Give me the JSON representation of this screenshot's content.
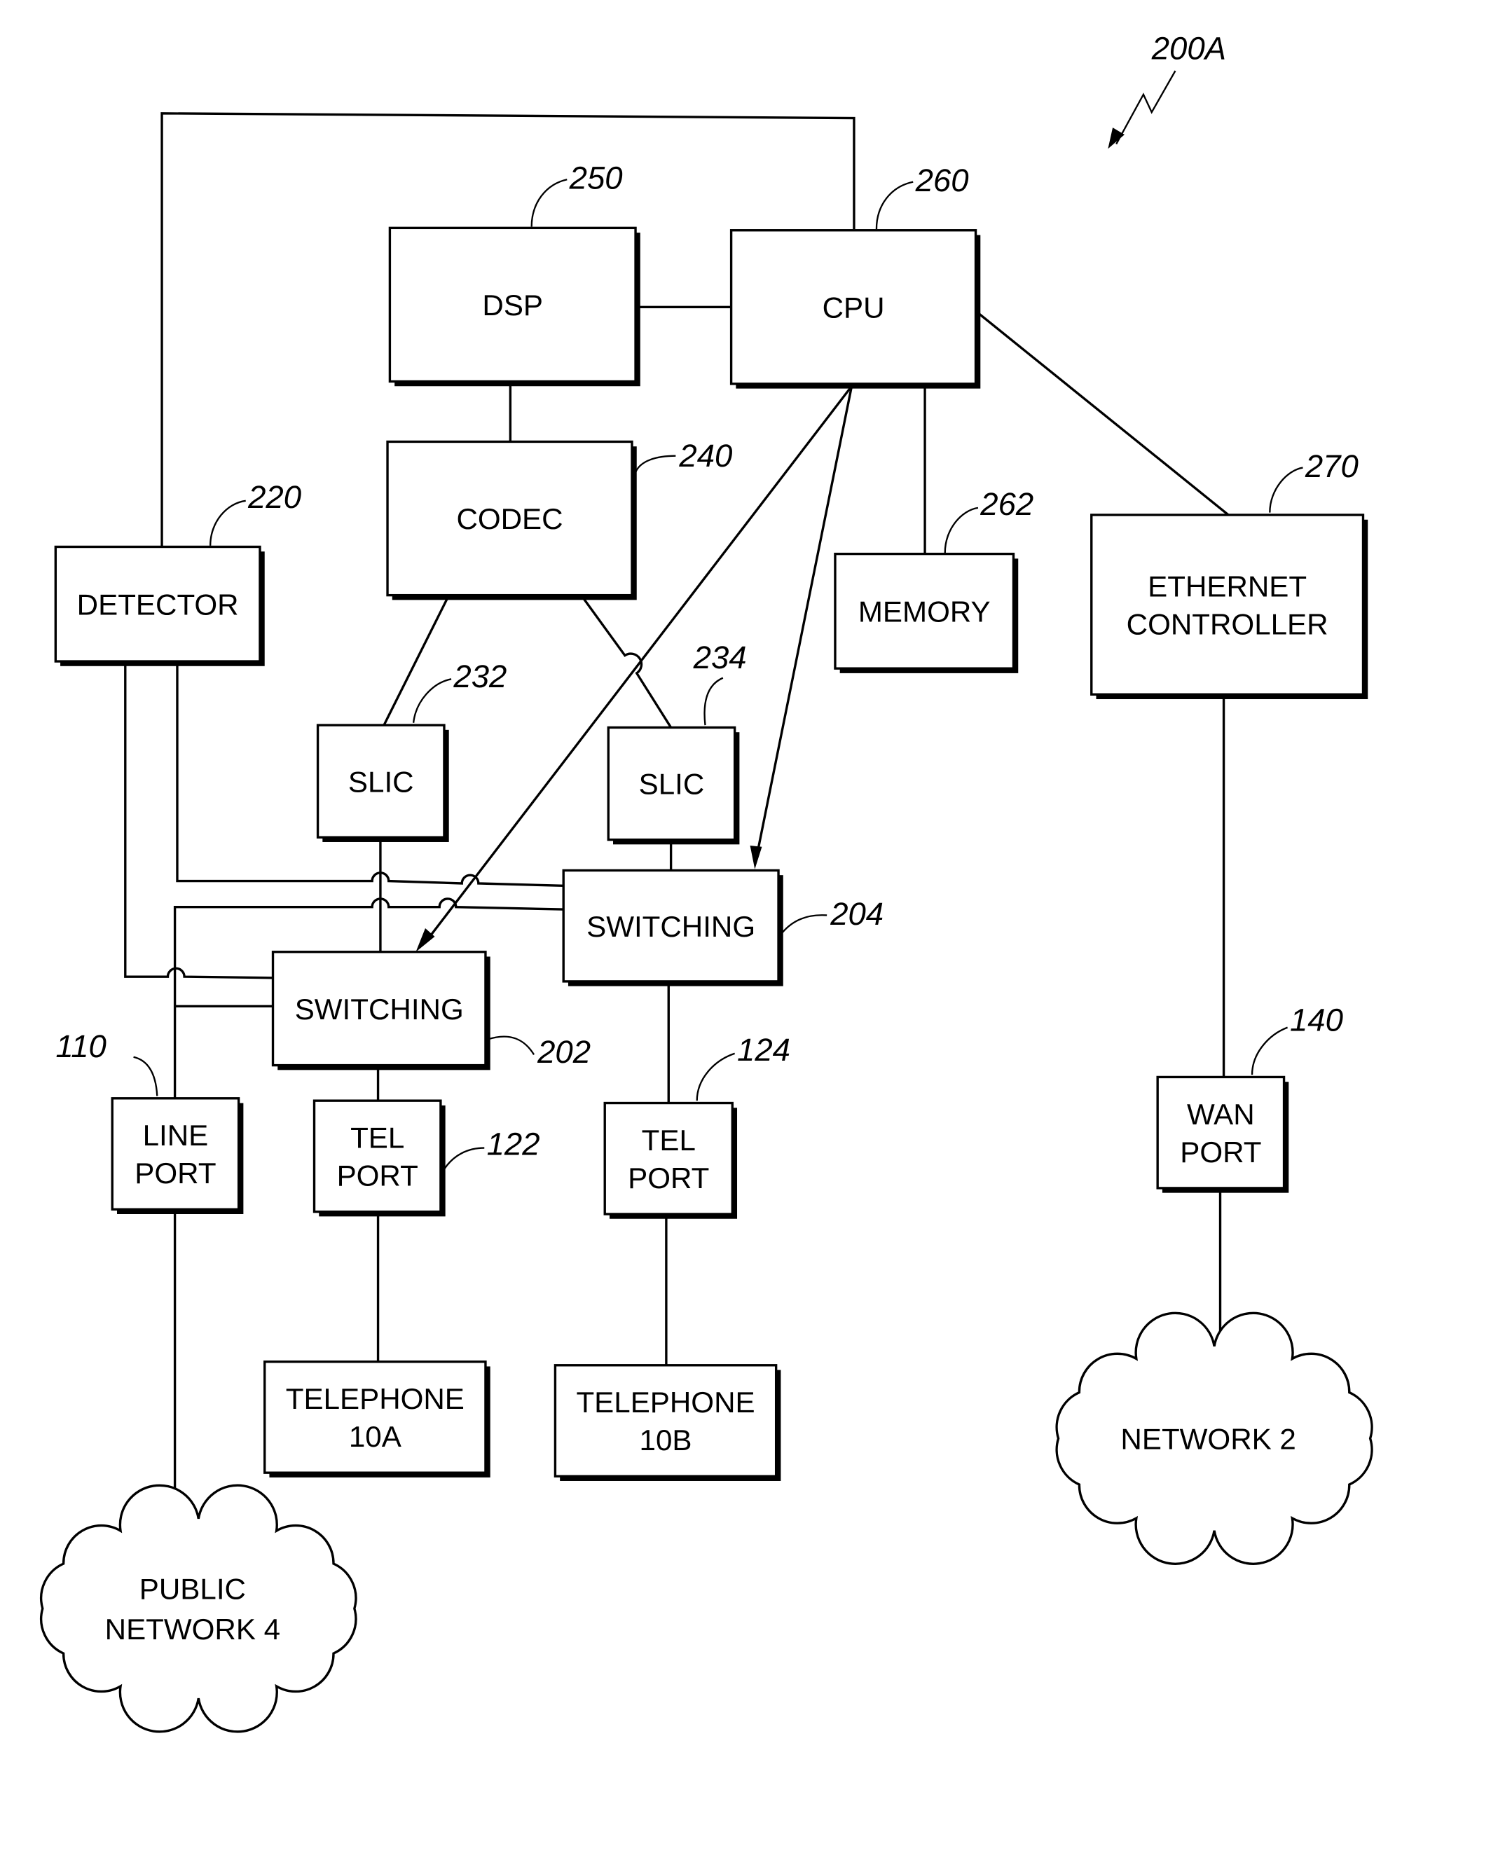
{
  "figure": {
    "reference": "200A",
    "blocks": [
      {
        "id": "dsp",
        "lines": [
          "DSP"
        ],
        "ref": "250"
      },
      {
        "id": "cpu",
        "lines": [
          "CPU"
        ],
        "ref": "260"
      },
      {
        "id": "codec",
        "lines": [
          "CODEC"
        ],
        "ref": "240"
      },
      {
        "id": "detector",
        "lines": [
          "DETECTOR"
        ],
        "ref": "220"
      },
      {
        "id": "memory",
        "lines": [
          "MEMORY"
        ],
        "ref": "262"
      },
      {
        "id": "ethernet",
        "lines": [
          "ETHERNET",
          "CONTROLLER"
        ],
        "ref": "270"
      },
      {
        "id": "slic1",
        "lines": [
          "SLIC"
        ],
        "ref": "232"
      },
      {
        "id": "slic2",
        "lines": [
          "SLIC"
        ],
        "ref": "234"
      },
      {
        "id": "switch204",
        "lines": [
          "SWITCHING"
        ],
        "ref": "204"
      },
      {
        "id": "switch202",
        "lines": [
          "SWITCHING"
        ],
        "ref": "202"
      },
      {
        "id": "lineport",
        "lines": [
          "LINE",
          "PORT"
        ],
        "ref": "110"
      },
      {
        "id": "telport122",
        "lines": [
          "TEL",
          "PORT"
        ],
        "ref": "122"
      },
      {
        "id": "telport124",
        "lines": [
          "TEL",
          "PORT"
        ],
        "ref": "124"
      },
      {
        "id": "wanport",
        "lines": [
          "WAN",
          "PORT"
        ],
        "ref": "140"
      },
      {
        "id": "tel10a",
        "lines": [
          "TELEPHONE",
          "10A"
        ],
        "ref": ""
      },
      {
        "id": "tel10b",
        "lines": [
          "TELEPHONE",
          "10B"
        ],
        "ref": ""
      }
    ],
    "clouds": [
      {
        "id": "public",
        "lines": [
          "PUBLIC",
          "NETWORK 4"
        ]
      },
      {
        "id": "net2",
        "lines": [
          "NETWORK 2"
        ]
      }
    ]
  }
}
